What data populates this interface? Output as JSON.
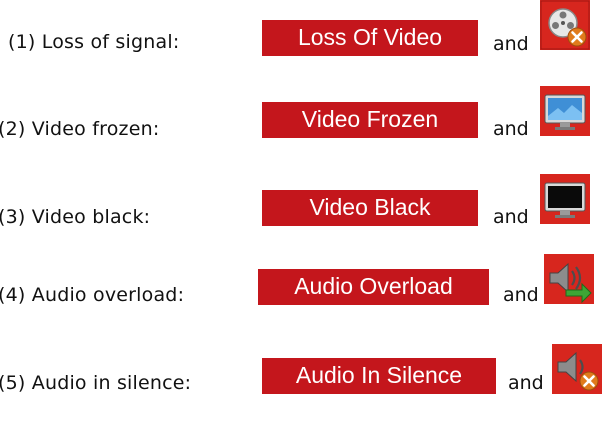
{
  "conditions": [
    {
      "description": "(1) Loss of signal:",
      "alarm": "Loss Of Video",
      "connector": "and",
      "icon": "film-reel-x-icon"
    },
    {
      "description": "(2) Video frozen:",
      "alarm": "Video Frozen",
      "connector": "and",
      "icon": "monitor-frozen-icon"
    },
    {
      "description": "(3) Video black:",
      "alarm": "Video Black",
      "connector": "and",
      "icon": "monitor-black-icon"
    },
    {
      "description": "(4) Audio overload:",
      "alarm": "Audio Overload",
      "connector": "and",
      "icon": "speaker-arrow-icon"
    },
    {
      "description": "(5) Audio in silence:",
      "alarm": "Audio In Silence",
      "connector": "and",
      "icon": "speaker-x-icon"
    }
  ],
  "colors": {
    "alarm_background": "#c4161c",
    "alarm_text": "#ffffff",
    "icon_background": "#d7261e"
  }
}
